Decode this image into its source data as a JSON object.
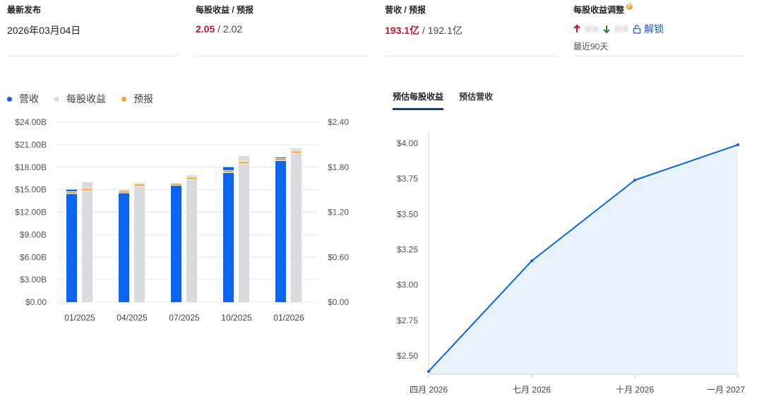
{
  "stats": {
    "latest": {
      "label": "最新发布",
      "value": "2026年03月04日"
    },
    "eps": {
      "label": "每股收益 / 预报",
      "actual": "2.05",
      "sep": " / ",
      "forecast": "2.02"
    },
    "revenue": {
      "label": "营收 / 预报",
      "actual": "193.1亿",
      "sep": " / ",
      "forecast": "192.1亿"
    },
    "revision": {
      "label": "每股收益调整",
      "badge": "P",
      "unlock_label": "解锁",
      "period": "最近90天"
    }
  },
  "colors": {
    "revenue": "#0a66f0",
    "eps": "#d9dbdd",
    "forecast": "#f5a623",
    "line": "#0a66e8",
    "area": "#e9f3fd",
    "up": "#c8102e",
    "down": "#1f8a3b"
  },
  "legend": [
    {
      "label": "营收",
      "color": "#0a66f0"
    },
    {
      "label": "每股收益",
      "color": "#d9dbdd"
    },
    {
      "label": "预报",
      "color": "#f5a623"
    }
  ],
  "tabs": [
    {
      "label": "预估每股收益",
      "active": true
    },
    {
      "label": "预估营收",
      "active": false
    }
  ],
  "chart_data": [
    {
      "type": "bar",
      "categories": [
        "01/2025",
        "04/2025",
        "07/2025",
        "10/2025",
        "01/2026"
      ],
      "left_axis": {
        "ticks": [
          "$0.00",
          "$3.00B",
          "$6.00B",
          "$9.00B",
          "$12.00B",
          "$15.00B",
          "$18.00B",
          "$21.00B",
          "$24.00B"
        ],
        "ylim": [
          0,
          24
        ]
      },
      "right_axis": {
        "ticks": [
          "$0.00",
          "$0.60",
          "$1.20",
          "$1.80",
          "$2.40"
        ],
        "ylim": [
          0,
          2.4
        ]
      },
      "series": [
        {
          "name": "营收",
          "axis": "left",
          "values": [
            15.0,
            14.9,
            15.8,
            18.0,
            19.3
          ],
          "forecast": [
            14.6,
            14.7,
            15.7,
            17.4,
            19.0
          ]
        },
        {
          "name": "每股收益",
          "axis": "right",
          "values": [
            1.6,
            1.59,
            1.69,
            1.95,
            2.05
          ],
          "forecast": [
            1.5,
            1.56,
            1.65,
            1.86,
            2.0
          ]
        }
      ],
      "grid": true,
      "legend_position": "top-left"
    },
    {
      "type": "area",
      "x": [
        "四月 2026",
        "七月 2026",
        "十月 2026",
        "一月 2027"
      ],
      "values": [
        2.39,
        3.17,
        3.74,
        3.99
      ],
      "y_ticks": [
        "$2.50",
        "$2.75",
        "$3.00",
        "$3.25",
        "$3.50",
        "$3.75",
        "$4.00"
      ],
      "ylim": [
        2.37,
        4.09
      ],
      "grid": false
    }
  ]
}
